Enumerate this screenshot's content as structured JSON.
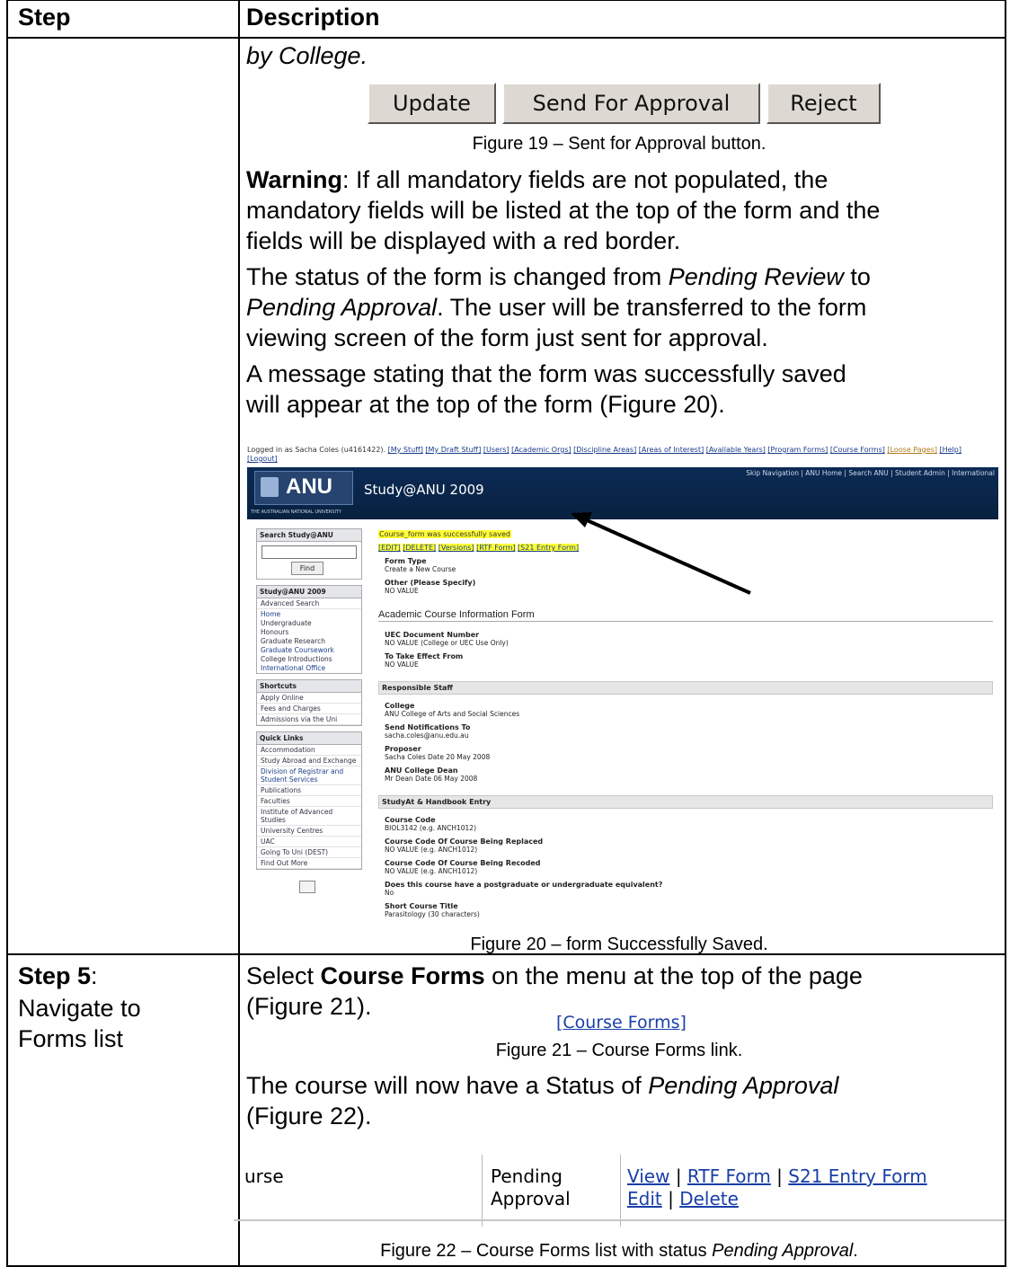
{
  "table": {
    "header_step": "Step",
    "header_description": "Description"
  },
  "row1": {
    "text_by_college": "by College.",
    "buttons": [
      "Update",
      "Send For Approval",
      "Reject"
    ],
    "fig19_caption": "Figure 19 – Sent for Approval button.",
    "warning_label": "Warning",
    "warning_text_1": ": If all mandatory fields are not populated, the",
    "warning_text_2": "mandatory fields will be listed at the top of the form and the",
    "warning_text_3": "fields will be displayed with a red border.",
    "status_1a": "The status of the form is changed from ",
    "status_1b": "Pending Review",
    "status_1c": " to",
    "status_2a": "Pending Approval",
    "status_2b": ".  The user will be transferred to the form",
    "status_3": "viewing screen of the form just sent for approval.",
    "message_1": "A message stating that the form was successfully saved",
    "message_2": "will appear at the top of the form (Figure 20).",
    "fig20_caption": "Figure 20 – form Successfully Saved."
  },
  "screenshot": {
    "logged_in": "Logged in as Sacha Coles (u4161422).",
    "top_links": [
      "[My Stuff]",
      "[My Draft Stuff]",
      "[Users]",
      "[Academic Orgs]",
      "[Discipline Areas]",
      "[Areas of Interest]",
      "[Available Years]",
      "[Program Forms]",
      "[Course Forms]",
      "[Loose Pages]",
      "[Help]"
    ],
    "logout": "[Logout]",
    "banner_nav": "Skip Navigation | ANU Home | Search ANU | Student Admin | International",
    "logo_text": "ANU",
    "logo_sub": "THE AUSTRALIAN NATIONAL UNIVERSITY",
    "site_title": "Study@ANU 2009",
    "search_header": "Search Study@ANU",
    "find_label": "Find",
    "study_header": "Study@ANU 2009",
    "study_items": [
      "Advanced Search",
      "Home",
      "Undergraduate",
      "Honours",
      "Graduate Research",
      "Graduate Coursework",
      "College Introductions",
      "International Office"
    ],
    "shortcuts_header": "Shortcuts",
    "shortcut_items": [
      "Apply Online",
      "Fees and Charges",
      "Admissions via the Uni"
    ],
    "quicklinks_header": "Quick Links",
    "quicklink_items": [
      "Accommodation",
      "Study Abroad and Exchange",
      "Division of Registrar and Student Services",
      "Publications",
      "Faculties",
      "Institute of Advanced Studies",
      "University Centres",
      "UAC",
      "Going To Uni (DEST)",
      "Find Out More"
    ],
    "saved_message": "Course_form was successfully saved",
    "action_links": [
      "[EDIT]",
      "[DELETE]",
      "[Versions]",
      "[RTF Form]",
      "[S21 Entry Form]"
    ],
    "form_type_label": "Form Type",
    "form_type_value": "Create a New Course",
    "other_label": "Other (Please Specify)",
    "other_value": "NO VALUE",
    "section_academic": "Academic Course Information Form",
    "uec_label": "UEC Document Number",
    "uec_value": "NO VALUE (College or UEC Use Only)",
    "effect_label": "To Take Effect From",
    "effect_value": "NO VALUE",
    "section_staff": "Responsible Staff",
    "college_label": "College",
    "college_value": "ANU College of Arts and Social Sciences",
    "notify_label": "Send Notifications To",
    "notify_value": "sacha.coles@anu.edu.au",
    "proposer_label": "Proposer",
    "proposer_value": "Sacha Coles Date 20 May 2008",
    "dean_label": "ANU College Dean",
    "dean_value": "Mr Dean Date 06 May 2008",
    "section_handbook": "StudyAt & Handbook Entry",
    "code_label": "Course Code",
    "code_value": "BIOL3142 (e.g. ANCH1012)",
    "replaced_label": "Course Code Of Course Being Replaced",
    "replaced_value": "NO VALUE (e.g. ANCH1012)",
    "recoded_label": "Course Code Of Course Being Recoded",
    "recoded_value": "NO VALUE (e.g. ANCH1012)",
    "equiv_label": "Does this course have a postgraduate or undergraduate equivalent?",
    "equiv_value": "No",
    "short_title_label": "Short Course Title",
    "short_title_value": "Parasitology (30 characters)"
  },
  "row2": {
    "step_label": "Step 5",
    "step_colon": ":",
    "step_desc_1": "Navigate to",
    "step_desc_2": "Forms list",
    "select_a": "Select ",
    "select_b": "Course Forms",
    "select_c": " on the menu at the top of the page",
    "select_2": "(Figure 21).",
    "course_forms_link": "[Course Forms]",
    "fig21_caption": "Figure 21 – Course Forms link.",
    "status_a": "The course will now have a Status of ",
    "status_b": "Pending Approval",
    "status_2": "(Figure 22).",
    "crop_name": "urse",
    "crop_status_1": "Pending",
    "crop_status_2": "Approval",
    "crop_view": "View",
    "crop_rtf": "RTF Form",
    "crop_s21": "S21 Entry Form",
    "crop_edit": "Edit",
    "crop_delete": "Delete",
    "crop_sep": " | ",
    "fig22_caption_a": "Figure 22 – Course Forms list with status ",
    "fig22_caption_b": "Pending Approval",
    "fig22_caption_c": "."
  }
}
